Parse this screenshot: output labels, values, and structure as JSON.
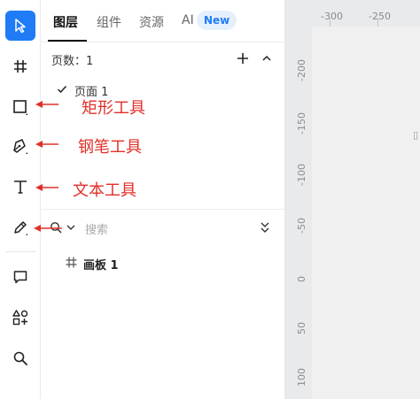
{
  "toolbar": {
    "tools": [
      {
        "name": "move-tool",
        "icon": "cursor-arrow-icon",
        "active": true
      },
      {
        "name": "frame-tool",
        "icon": "frame-hash-icon"
      },
      {
        "name": "rectangle-tool",
        "icon": "rectangle-icon"
      },
      {
        "name": "pen-tool",
        "icon": "pen-nib-icon"
      },
      {
        "name": "text-tool",
        "icon": "text-T-icon"
      },
      {
        "name": "pencil-tool",
        "icon": "pencil-icon"
      },
      {
        "name": "comment-tool",
        "icon": "comment-bubble-icon"
      },
      {
        "name": "plugins-tool",
        "icon": "shapes-plus-icon"
      },
      {
        "name": "zoom-search-tool",
        "icon": "magnifier-icon"
      }
    ],
    "accent": "#1f7cf6"
  },
  "tabs": {
    "layers": "图层",
    "components": "组件",
    "assets": "资源",
    "ai": "AI",
    "ai_badge": "New"
  },
  "pages": {
    "count_label": "页数：1",
    "items": [
      {
        "label": "页面 1",
        "selected": true
      }
    ]
  },
  "layers": {
    "search_placeholder": "搜索",
    "items": [
      {
        "label": "画板 1",
        "icon": "frame-hash-icon"
      }
    ]
  },
  "annotations": {
    "rectangle": "矩形工具",
    "pen": "钢笔工具",
    "text": "文本工具",
    "color": "#e0302a"
  },
  "ruler": {
    "top_labels": [
      "-300",
      "-250"
    ],
    "left_labels": [
      "-200",
      "-150",
      "-100",
      "-50",
      "0",
      "50",
      "100"
    ]
  }
}
